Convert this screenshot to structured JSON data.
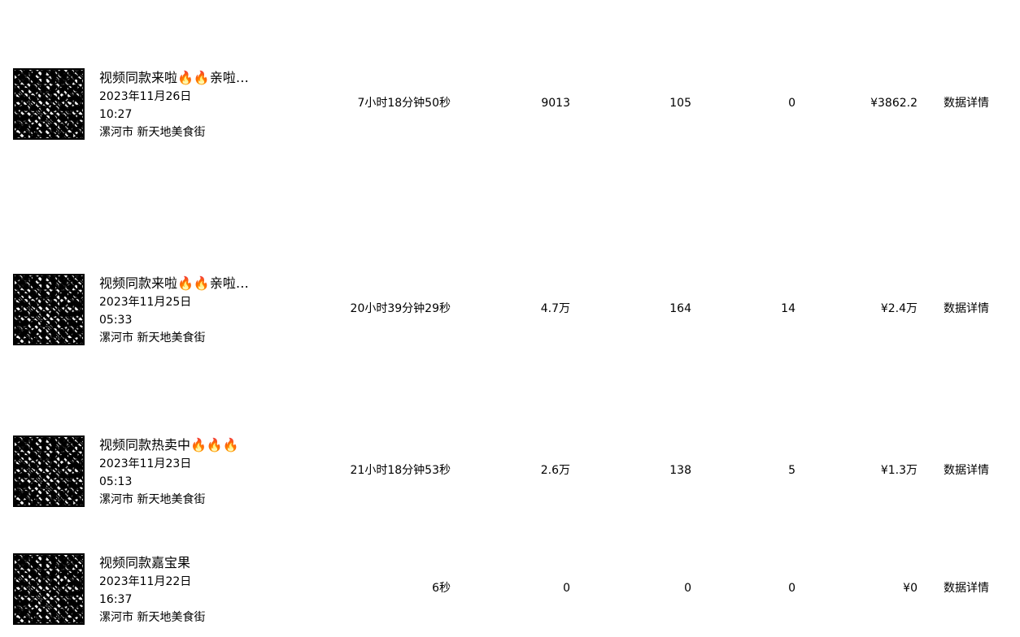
{
  "rows": [
    {
      "title": "视频同款来啦🔥🔥亲啦…",
      "date": "2023年11月26日",
      "time": "10:27",
      "location": "漯河市 新天地美食街",
      "duration": "7小时18分钟50秒",
      "col_a": "9013",
      "col_b": "105",
      "col_c": "0",
      "amount": "¥3862.2",
      "link": "数据详情"
    },
    {
      "title": "视频同款来啦🔥🔥亲啦…",
      "date": "2023年11月25日",
      "time": "05:33",
      "location": "漯河市 新天地美食街",
      "duration": "20小时39分钟29秒",
      "col_a": "4.7万",
      "col_b": "164",
      "col_c": "14",
      "amount": "¥2.4万",
      "link": "数据详情"
    },
    {
      "title": "视频同款热卖中🔥🔥🔥",
      "date": "2023年11月23日",
      "time": "05:13",
      "location": "漯河市 新天地美食街",
      "duration": "21小时18分钟53秒",
      "col_a": "2.6万",
      "col_b": "138",
      "col_c": "5",
      "amount": "¥1.3万",
      "link": "数据详情"
    },
    {
      "title": "视频同款嘉宝果",
      "date": "2023年11月22日",
      "time": "16:37",
      "location": "漯河市 新天地美食街",
      "duration": "6秒",
      "col_a": "0",
      "col_b": "0",
      "col_c": "0",
      "amount": "¥0",
      "link": "数据详情"
    }
  ]
}
